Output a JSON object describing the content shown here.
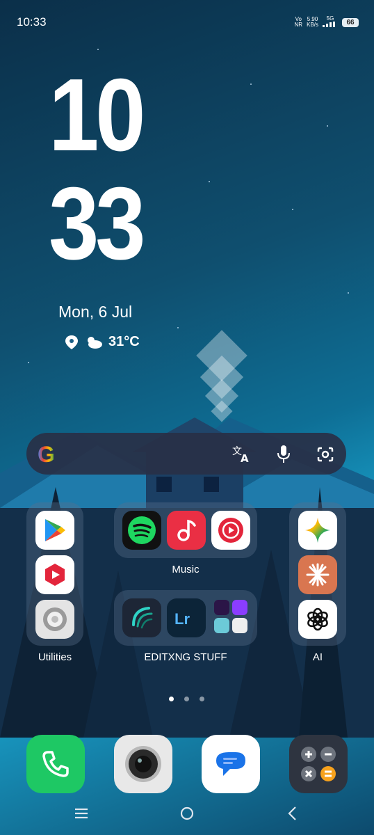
{
  "status_bar": {
    "time": "10:33",
    "network_top": "Vo",
    "network_bottom": "NR",
    "speed_top": "5.90",
    "speed_bottom": "KB/s",
    "signal_label": "5G",
    "battery": "66"
  },
  "clock": {
    "hour": "10",
    "minute": "33"
  },
  "date": "Mon, 6 Jul",
  "weather": {
    "temperature": "31°C",
    "icon": "partly-cloudy-icon"
  },
  "search_widget": {
    "logo": "G",
    "icons": [
      "translate-icon",
      "mic-icon",
      "lens-icon"
    ]
  },
  "folders": {
    "utilities": {
      "label": "Utilities",
      "apps": [
        "Play Store",
        "YouTube Create",
        "Settings"
      ]
    },
    "music": {
      "label": "Music",
      "apps": [
        "Spotify",
        "Music",
        "YouTube Music"
      ]
    },
    "editing": {
      "label": "EDITXNG STUFF",
      "apps": [
        "Alight Motion",
        "Lightroom",
        "mini apps"
      ]
    },
    "ai": {
      "label": "AI",
      "apps": [
        "Gemini",
        "Claude",
        "ChatGPT"
      ]
    }
  },
  "page_indicator": {
    "pages": 3,
    "current": 1
  },
  "dock": [
    "Phone",
    "Camera",
    "Messages",
    "Calculator"
  ],
  "nav": [
    "menu-icon",
    "home-icon",
    "back-icon"
  ],
  "colors": {
    "accent": "#1aa5cf",
    "phone": "#1ec864",
    "music_red": "#ea2f44",
    "spotify_green": "#1ed760"
  }
}
